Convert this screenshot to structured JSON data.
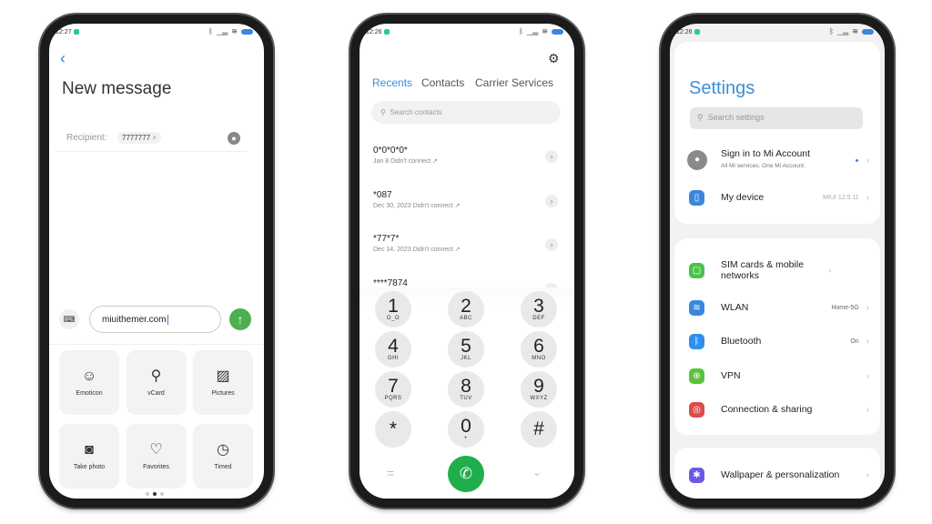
{
  "messaging": {
    "status_time": "12:27",
    "title": "New message",
    "recipient_label": "Recipient:",
    "recipient_chip": "7777777",
    "chip_remove": "×",
    "input_value": "miuithemer.com",
    "tiles": [
      {
        "label": "Emoticon",
        "icon": "smiley-icon",
        "glyph": "☺"
      },
      {
        "label": "vCard",
        "icon": "person-icon",
        "glyph": "⚲"
      },
      {
        "label": "Pictures",
        "icon": "image-icon",
        "glyph": "▨"
      },
      {
        "label": "Take photo",
        "icon": "camera-icon",
        "glyph": "◙"
      },
      {
        "label": "Favorites",
        "icon": "heart-icon",
        "glyph": "♡"
      },
      {
        "label": "Timed",
        "icon": "clock-icon",
        "glyph": "◷"
      }
    ],
    "page_indicator": {
      "pages": 3,
      "current": 2
    },
    "accent": "#4caf50"
  },
  "dialer": {
    "status_time": "12:26",
    "tabs": [
      {
        "label": "Recents",
        "active": true
      },
      {
        "label": "Contacts"
      },
      {
        "label": "Carrier Services"
      }
    ],
    "search_placeholder": "Search contacts",
    "recents": [
      {
        "number": "0*0*0*0*",
        "detail": "Jan 8 Didn't connect ↗"
      },
      {
        "number": "*087",
        "detail": "Dec 30, 2023 Didn't connect ↗"
      },
      {
        "number": "*77*7*",
        "detail": "Dec 14, 2023 Didn't connect ↗"
      },
      {
        "number": "****7874",
        "detail": ""
      }
    ],
    "keys": [
      {
        "d": "1",
        "l": "O_O"
      },
      {
        "d": "2",
        "l": "ABC"
      },
      {
        "d": "3",
        "l": "DEF"
      },
      {
        "d": "4",
        "l": "GHI"
      },
      {
        "d": "5",
        "l": "JKL"
      },
      {
        "d": "6",
        "l": "MNO"
      },
      {
        "d": "7",
        "l": "PQRS"
      },
      {
        "d": "8",
        "l": "TUV"
      },
      {
        "d": "9",
        "l": "WXYZ"
      },
      {
        "d": "*",
        "l": ""
      },
      {
        "d": "0",
        "l": "+"
      },
      {
        "d": "#",
        "l": ""
      }
    ],
    "accent": "#1fae4b",
    "tab_color": "#3a8fd9"
  },
  "settings": {
    "status_time": "12:26",
    "title": "Settings",
    "search_placeholder": "Search settings",
    "account": {
      "title": "Sign in to Mi Account",
      "subtitle": "All Mi services. One Mi Account."
    },
    "device": {
      "title": "My device",
      "value": "MIUI 12.5.11"
    },
    "network": [
      {
        "title": "SIM cards & mobile networks",
        "value": "",
        "icon": "sim-icon",
        "color": "#4cc24a",
        "glyph": "▢"
      },
      {
        "title": "WLAN",
        "value": "Home-5G",
        "icon": "wifi-icon",
        "color": "#3a86e0",
        "glyph": "≋"
      },
      {
        "title": "Bluetooth",
        "value": "On",
        "icon": "bluetooth-icon",
        "color": "#2f8fef",
        "glyph": "ᛒ"
      },
      {
        "title": "VPN",
        "value": "",
        "icon": "globe-icon",
        "color": "#5cc23d",
        "glyph": "⊕"
      },
      {
        "title": "Connection & sharing",
        "value": "",
        "icon": "share-icon",
        "color": "#e04b4b",
        "glyph": "◎"
      }
    ],
    "personal": [
      {
        "title": "Wallpaper & personalization",
        "icon": "wallpaper-icon",
        "color": "#6a5be0",
        "glyph": "✱"
      }
    ],
    "accent": "#3a8fd9"
  }
}
